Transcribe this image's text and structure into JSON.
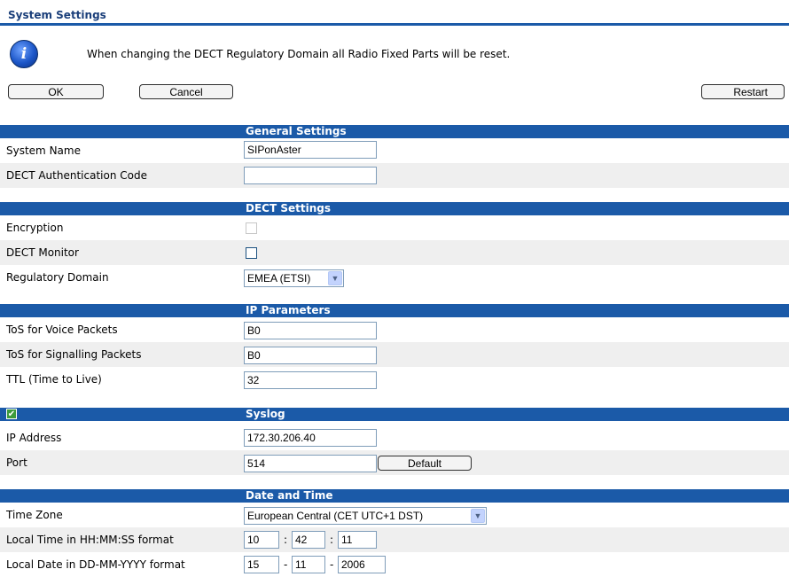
{
  "page": {
    "title": "System Settings",
    "info_icon": "info-icon",
    "info_text": "When changing the DECT Regulatory Domain all Radio Fixed Parts will be reset."
  },
  "buttons": {
    "ok": "OK",
    "cancel": "Cancel",
    "restart": "Restart",
    "default": "Default"
  },
  "general": {
    "header": "General Settings",
    "system_name_label": "System Name",
    "system_name_value": "SIPonAster",
    "auth_code_label": "DECT Authentication Code",
    "auth_code_value": ""
  },
  "dect": {
    "header": "DECT Settings",
    "encryption_label": "Encryption",
    "encryption_checked": false,
    "monitor_label": "DECT Monitor",
    "monitor_checked": false,
    "domain_label": "Regulatory Domain",
    "domain_value": "EMEA (ETSI)"
  },
  "ip": {
    "header": "IP Parameters",
    "tos_voice_label": "ToS for Voice Packets",
    "tos_voice_value": "B0",
    "tos_signal_label": "ToS for Signalling Packets",
    "tos_signal_value": "B0",
    "ttl_label": "TTL (Time to Live)",
    "ttl_value": "32"
  },
  "syslog": {
    "header": "Syslog",
    "enabled": true,
    "ip_label": "IP Address",
    "ip_value": "172.30.206.40",
    "port_label": "Port",
    "port_value": "514"
  },
  "datetime": {
    "header": "Date and Time",
    "tz_label": "Time Zone",
    "tz_value": "European Central (CET UTC+1 DST)",
    "time_label": "Local Time in HH:MM:SS format",
    "hh": "10",
    "mm": "42",
    "ss": "11",
    "time_sep": ":",
    "date_label": "Local Date in DD-MM-YYYY format",
    "dd": "15",
    "mon": "11",
    "yyyy": "2006",
    "date_sep": "-"
  },
  "colors": {
    "header_bg": "#1b5aa8",
    "title": "#1b3f7a",
    "row_alt": "#efefef"
  }
}
